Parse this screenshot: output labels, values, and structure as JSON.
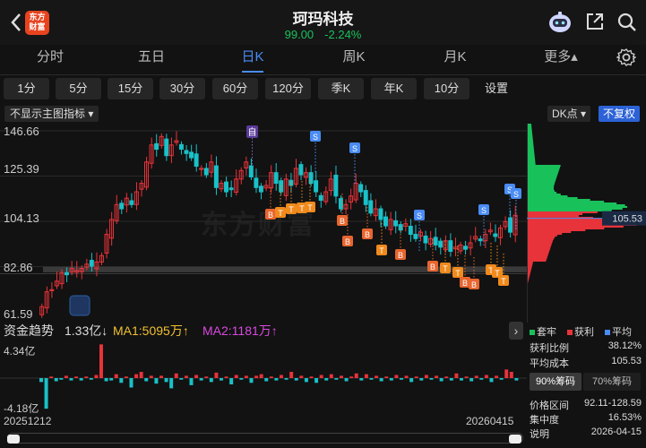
{
  "header": {
    "logo_text_line1": "东方",
    "logo_text_line2": "财富",
    "title": "珂玛科技",
    "price": "99.00",
    "change": "-2.24%"
  },
  "tabs": [
    {
      "label": "分时"
    },
    {
      "label": "五日"
    },
    {
      "label": "日K",
      "active": true
    },
    {
      "label": "周K"
    },
    {
      "label": "月K"
    },
    {
      "label": "更多▴"
    }
  ],
  "minute_buttons": [
    "1分",
    "5分",
    "15分",
    "30分",
    "60分",
    "120分",
    "季K",
    "年K",
    "10分"
  ],
  "settings_label": "设置",
  "chart": {
    "main_indicator": "不显示主图指标",
    "dk_label": "DK点",
    "fq_label": "不复权",
    "y_labels": [
      "146.66",
      "125.39",
      "104.13",
      "82.86",
      "61.59"
    ],
    "event_label": "自",
    "watermark": "东方财富",
    "current_price_tag": "105.53",
    "chart_data": {
      "type": "candlestick",
      "y_range": [
        61.59,
        146.66
      ],
      "x_start": "20251212",
      "x_end": "20260415"
    }
  },
  "fund_row": {
    "label": "资金趋势",
    "value": "1.33亿↓",
    "ma1": "MA1:5095万↑",
    "ma2": "MA2:1181万↑"
  },
  "volume": {
    "top_label": "4.34亿",
    "bottom_label": "-4.18亿"
  },
  "dates": {
    "start": "20251212",
    "end": "20260415"
  },
  "legend": [
    {
      "label": "套牢",
      "color": "#19c15b"
    },
    {
      "label": "获利",
      "color": "#e8333a"
    },
    {
      "label": "平均",
      "color": "#4a8cf6"
    }
  ],
  "chips_panel": {
    "profit_ratio_label": "获利比例",
    "profit_ratio": "38.12%",
    "avg_cost_label": "平均成本",
    "avg_cost": "105.53",
    "chip90_label": "90%筹码",
    "chip70_label": "70%筹码",
    "price_range_label": "价格区间",
    "price_range": "92.11-128.59",
    "concentration_label": "集中度",
    "concentration": "16.53%",
    "note_label": "说明",
    "note_date": "2026-04-15"
  },
  "colors": {
    "up": "#e8333a",
    "down": "#19c1c8",
    "accent": "#4a8cf6",
    "bg": "#121212"
  }
}
